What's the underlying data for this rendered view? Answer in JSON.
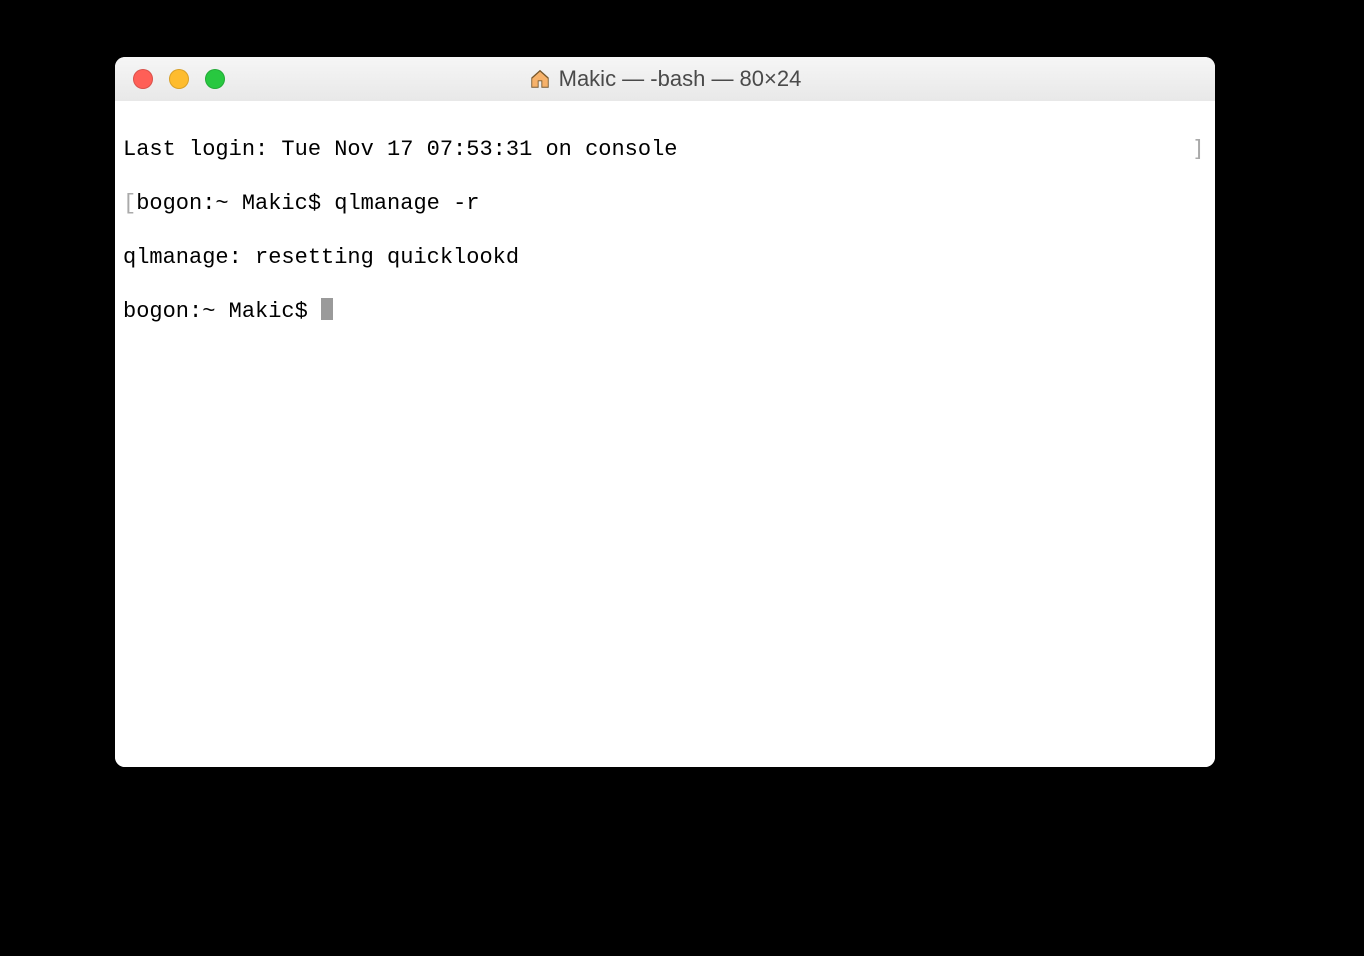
{
  "window": {
    "title": "Makic — -bash — 80×24"
  },
  "terminal": {
    "lines": {
      "last_login": "Last login: Tue Nov 17 07:53:31 on console",
      "left_bracket": "[",
      "prompt1_prefix": "bogon:~ Makic$ ",
      "command1": "qlmanage -r",
      "output1": "qlmanage: resetting quicklookd",
      "prompt2": "bogon:~ Makic$ ",
      "right_bracket": "]"
    }
  }
}
